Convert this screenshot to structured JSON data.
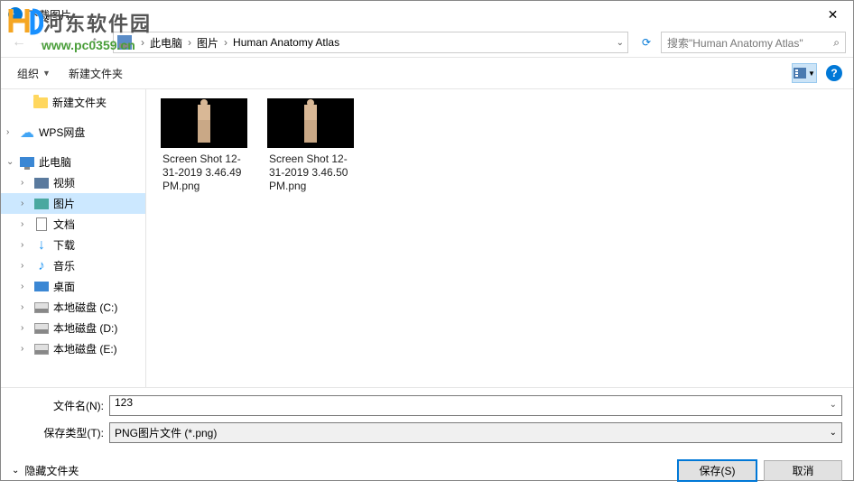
{
  "watermark": {
    "brand": "河东软件园",
    "url": "www.pc0359.cn"
  },
  "title": "下载图片",
  "breadcrumb": {
    "root": "此电脑",
    "p1": "图片",
    "p2": "Human Anatomy Atlas"
  },
  "search": {
    "placeholder": "搜索\"Human Anatomy Atlas\""
  },
  "toolbar": {
    "organize": "组织",
    "newfolder": "新建文件夹"
  },
  "sidebar": {
    "items": [
      {
        "label": "新建文件夹"
      },
      {
        "label": "WPS网盘"
      },
      {
        "label": "此电脑"
      },
      {
        "label": "视频"
      },
      {
        "label": "图片"
      },
      {
        "label": "文档"
      },
      {
        "label": "下载"
      },
      {
        "label": "音乐"
      },
      {
        "label": "桌面"
      },
      {
        "label": "本地磁盘 (C:)"
      },
      {
        "label": "本地磁盘 (D:)"
      },
      {
        "label": "本地磁盘 (E:)"
      }
    ]
  },
  "files": [
    {
      "name": "Screen Shot 12-31-2019 3.46.49 PM.png"
    },
    {
      "name": "Screen Shot 12-31-2019 3.46.50 PM.png"
    }
  ],
  "filename": {
    "label": "文件名(N):",
    "value": "123"
  },
  "filetype": {
    "label": "保存类型(T):",
    "value": "PNG图片文件 (*.png)"
  },
  "footer": {
    "hide": "隐藏文件夹",
    "save": "保存(S)",
    "cancel": "取消"
  }
}
